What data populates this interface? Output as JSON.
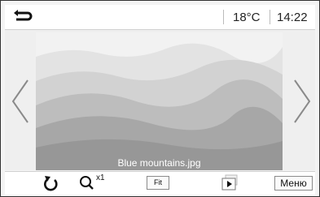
{
  "status_bar": {
    "back_icon": "back-arrow-icon",
    "temperature": "18°C",
    "time": "14:22"
  },
  "viewer": {
    "file_name": "Blue mountains.jpg",
    "prev_icon": "chevron-left-icon",
    "next_icon": "chevron-right-icon"
  },
  "toolbar": {
    "rotate_icon": "rotate-icon",
    "zoom_icon": "magnifier-icon",
    "zoom_label": "x1",
    "fit_label": "Fit",
    "slideshow_icon": "slideshow-play-icon",
    "menu_label": "Меню"
  },
  "colors": {
    "sky": "#f2f2f2",
    "mountain_light": "#d9d9d9",
    "mountain_dark": "#9a9a9a"
  }
}
